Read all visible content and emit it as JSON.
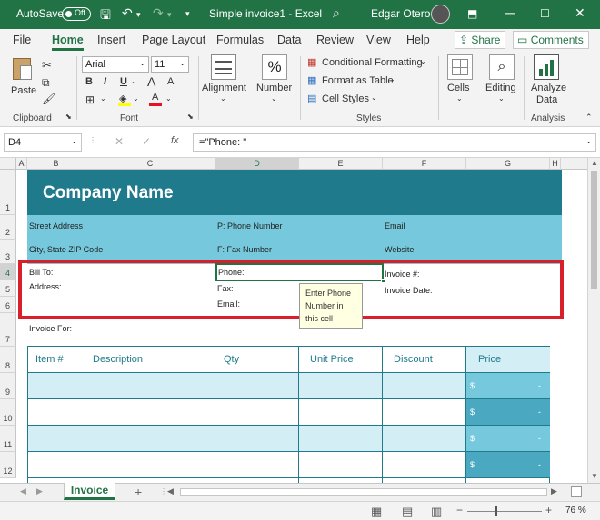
{
  "titlebar": {
    "autosave_label": "AutoSave",
    "autosave_state": "Off",
    "doc_title": "Simple invoice1  -  Excel",
    "user_name": "Edgar Otero"
  },
  "tabs": [
    "File",
    "Home",
    "Insert",
    "Page Layout",
    "Formulas",
    "Data",
    "Review",
    "View",
    "Help"
  ],
  "share_label": "Share",
  "comments_label": "Comments",
  "ribbon": {
    "paste_label": "Paste",
    "clipboard_label": "Clipboard",
    "font_name": "Arial",
    "font_size": "11",
    "font_label": "Font",
    "alignment_label": "Alignment",
    "number_label": "Number",
    "conditional_formatting": "Conditional Formatting",
    "format_as_table": "Format as Table",
    "cell_styles": "Cell Styles",
    "styles_label": "Styles",
    "cells_label": "Cells",
    "editing_label": "Editing",
    "analyze_data_line1": "Analyze",
    "analyze_data_line2": "Data",
    "analysis_label": "Analysis"
  },
  "formula_bar": {
    "name_box": "D4",
    "fx": "fx",
    "formula": "=\"Phone:  \""
  },
  "columns": [
    "A",
    "B",
    "C",
    "D",
    "E",
    "F",
    "G",
    "H"
  ],
  "rows": [
    "1",
    "2",
    "3",
    "4",
    "5",
    "6",
    "7",
    "8",
    "9",
    "10",
    "11",
    "12"
  ],
  "invoice": {
    "company_name": "Company Name",
    "street_address": "Street Address",
    "phone_number": "P: Phone Number",
    "email": "Email",
    "city_state": "City, State ZIP Code",
    "fax_number": "F: Fax Number",
    "website": "Website",
    "bill_to": "Bill To:",
    "address": "Address:",
    "phone": "Phone:",
    "fax": "Fax:",
    "email_field": "Email:",
    "invoice_no": "Invoice #:",
    "invoice_date": "Invoice Date:",
    "invoice_for": "Invoice For:",
    "tooltip_line1": "Enter Phone",
    "tooltip_line2": "Number in",
    "tooltip_line3": "this cell",
    "headers": [
      "Item #",
      "Description",
      "Qty",
      "Unit Price",
      "Discount",
      "Price"
    ],
    "currency": "$",
    "dash": "-"
  },
  "sheet_tab": "Invoice",
  "add_sheet": "+",
  "zoom": "76 %",
  "colors": {
    "excel_green": "#217346",
    "header_teal": "#1f7a8c",
    "light_teal": "#76c9dc",
    "pale_teal": "#d3eef4",
    "highlight_red": "#d9202a"
  }
}
